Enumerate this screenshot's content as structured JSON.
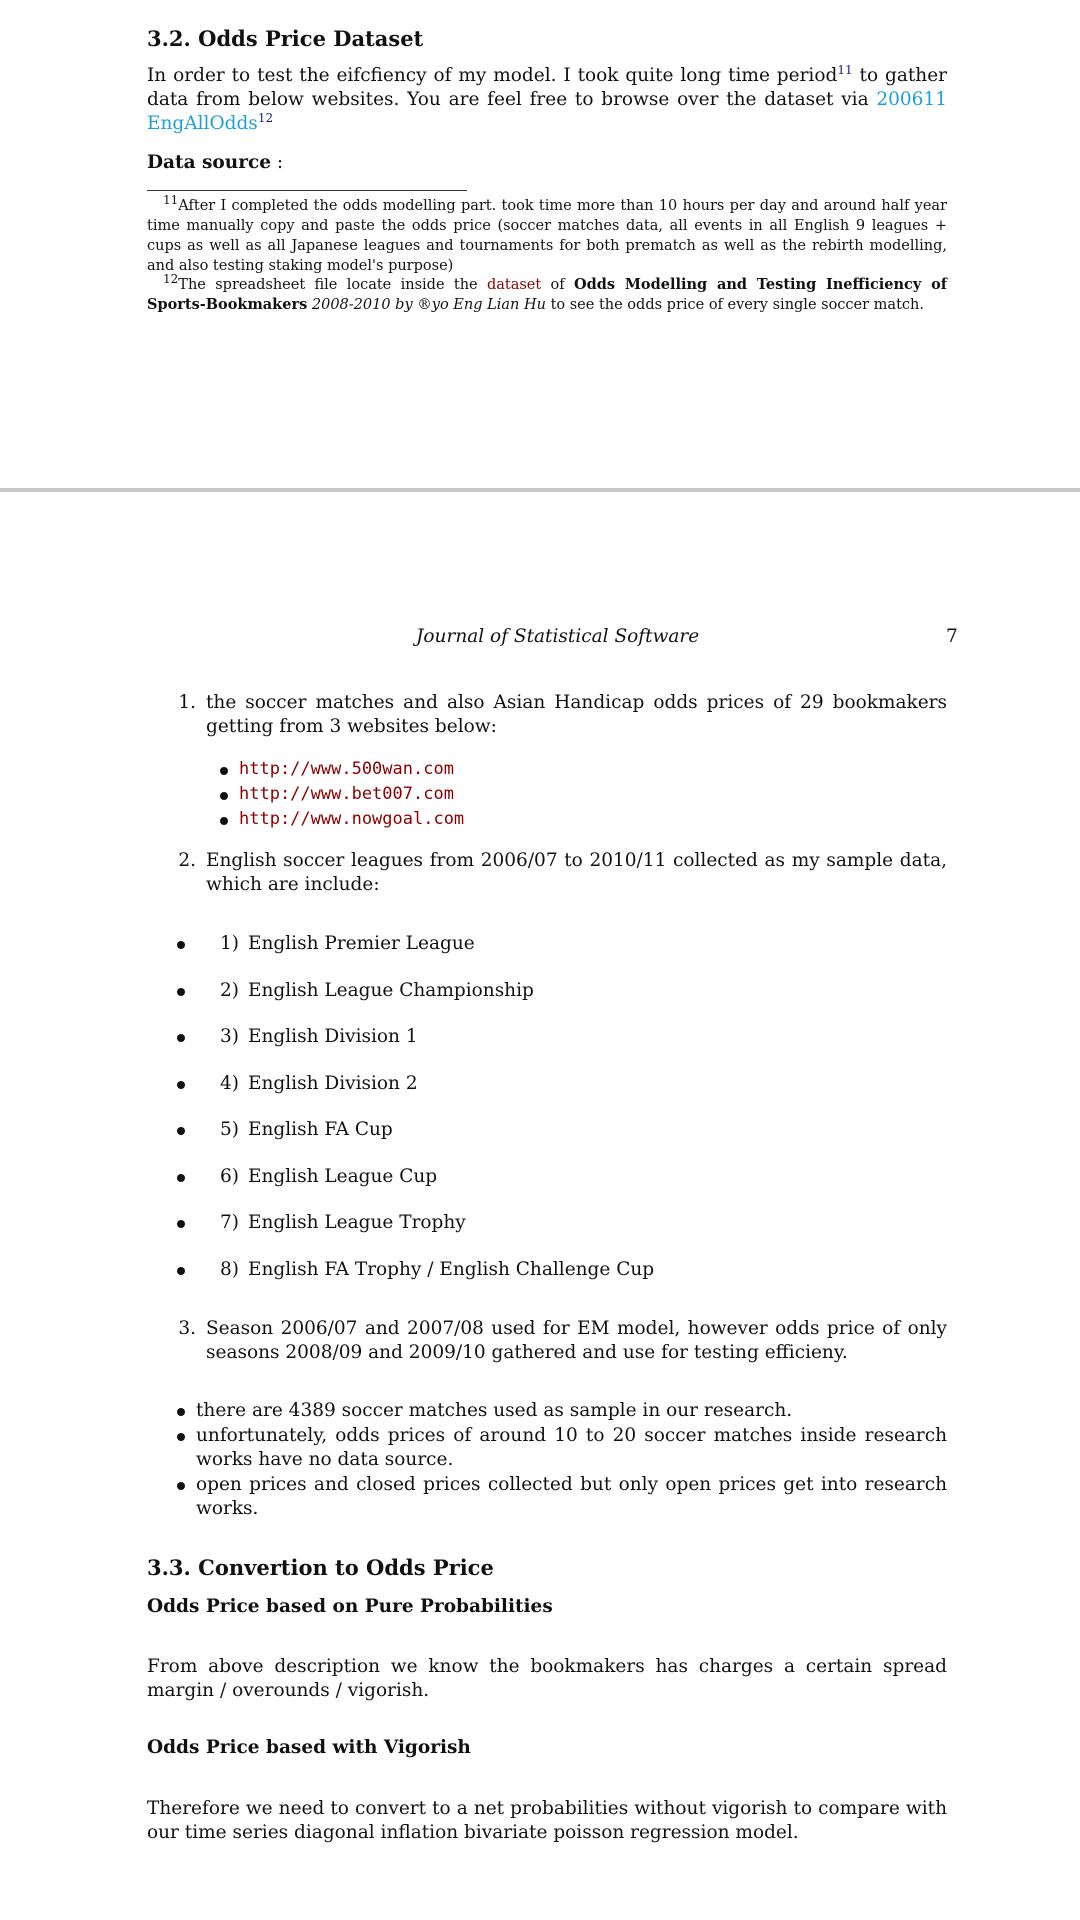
{
  "top_page": {
    "section_heading": "3.2.  Odds Price Dataset",
    "intro_text_1": "In order to test the eifcfiency of my model.  I took quite long time period",
    "intro_sup_1": "11",
    "intro_text_2": " to gather data from below websites.  You are feel free to browse over the dataset via ",
    "intro_link": "200611 EngAllOdds",
    "intro_sup_2": "12",
    "data_source_label": "Data source",
    "data_source_colon": " :",
    "footnote_11_mark": "11",
    "footnote_11_text": "After I completed the odds modelling part.  took time more than 10 hours per day and around half year time manually copy and paste the odds price (soccer matches data, all events in all English 9 leagues + cups as well as all Japanese leagues and tournaments for both prematch as well as the rebirth modelling, and also testing staking model's purpose)",
    "footnote_12_mark": "12",
    "footnote_12_pre": "The spreadsheet file locate inside the ",
    "footnote_12_link": "dataset",
    "footnote_12_mid": " of ",
    "footnote_12_bold": "Odds Modelling and Testing Inefficiency of Sports-Bookmakers",
    "footnote_12_italic": " 2008-2010 by ®yo Eng Lian Hu",
    "footnote_12_post": " to see the odds price of every single soccer match."
  },
  "bottom_page": {
    "running_header": "Journal of Statistical Software",
    "page_number": "7",
    "list": [
      {
        "num": "1.",
        "text": "the soccer matches and also Asian Handicap odds prices of 29 bookmakers getting from 3 websites below:"
      },
      {
        "num": "2.",
        "text": "English soccer leagues from 2006/07 to 2010/11 collected as my sample data, which are include:"
      },
      {
        "num": "3.",
        "text": "Season 2006/07 and 2007/08 used for EM model, however odds price of only seasons 2008/09 and 2009/10 gathered and use for testing efficieny."
      }
    ],
    "websites": [
      "http://www.500wan.com",
      "http://www.bet007.com",
      "http://www.nowgoal.com"
    ],
    "leagues": [
      {
        "num": "1)",
        "name": "English Premier League"
      },
      {
        "num": "2)",
        "name": "English League Championship"
      },
      {
        "num": "3)",
        "name": "English Division 1"
      },
      {
        "num": "4)",
        "name": "English Division 2"
      },
      {
        "num": "5)",
        "name": "English FA Cup"
      },
      {
        "num": "6)",
        "name": "English League Cup"
      },
      {
        "num": "7)",
        "name": "English League Trophy"
      },
      {
        "num": "8)",
        "name": "English FA Trophy / English Challenge Cup"
      }
    ],
    "notes": [
      "there are 4389 soccer matches used as sample in our research.",
      "unfortunately, odds prices of around 10 to 20 soccer matches inside research works have no data source.",
      "open prices and closed prices collected but only open prices get into research works."
    ],
    "section_33": "3.3.  Convertion to Odds Price",
    "sub_pure": "Odds Price based on Pure Probabilities",
    "para_pure": "From above description we know the bookmakers has charges a certain spread margin / overounds / vigorish.",
    "sub_vig": "Odds Price based with Vigorish",
    "para_vig": "Therefore we need to convert to a net probabilities without vigorish to compare with our time series diagonal inflation bivariate poisson regression model."
  },
  "colors": {
    "page_divider": "#c8c8c8",
    "link_cyan": "#1ea0d8",
    "link_red": "#8b0000",
    "footnote_mark": "#1a1a8c"
  }
}
